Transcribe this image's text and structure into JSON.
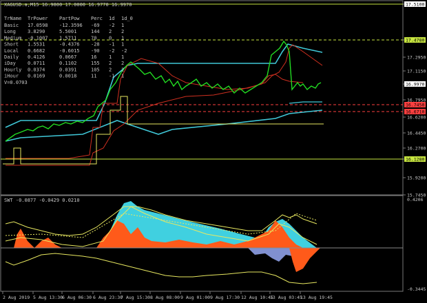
{
  "main_panel": {
    "title": "XAGUSD.a,M15  16.9800 17.0000 16.9770 16.9970",
    "table": {
      "headers": [
        "TrName",
        "TrPower",
        "PartPow",
        "Perc",
        "1d",
        "1d_0"
      ],
      "rows": [
        [
          "Basic",
          "17.0598",
          "-12.3596",
          "-69",
          "-2",
          "1"
        ],
        [
          "Long",
          "3.8290",
          "5.5001",
          "144",
          "2",
          "2"
        ],
        [
          "Medium",
          "-0.1007",
          "1.5711",
          "70",
          "0",
          "1"
        ],
        [
          "Short",
          "1.5531",
          "-0.4376",
          "-28",
          "-1",
          "1"
        ],
        [
          "Local",
          "0.6682",
          "-0.6015",
          "-90",
          "-2",
          "-2"
        ],
        [
          "Daily",
          "0.4126",
          "0.0667",
          "16",
          "1",
          "1"
        ],
        [
          "iDay",
          "0.0711",
          "0.1102",
          "155",
          "2",
          "2"
        ],
        [
          "Hourly",
          "0.0374",
          "0.0391",
          "105",
          "2",
          "2"
        ],
        [
          "iHour",
          "0.0169",
          "0.0018",
          "11",
          "-1",
          "1"
        ]
      ],
      "footer": "V=0.0703"
    },
    "price_axis": [
      "17.5100",
      "17.4780",
      "17.2950",
      "17.1150",
      "16.9970",
      "16.7950",
      "16.6200",
      "16.4450",
      "16.2700",
      "16.1280",
      "15.9200",
      "15.7450"
    ],
    "price_tags": [
      {
        "label": "17.5100",
        "color": "#ffffff"
      },
      {
        "label": "17.4780",
        "color": "#c8e640"
      },
      {
        "label": "16.9970",
        "color": "#ffffff"
      },
      {
        "label": "16.7450",
        "color": "#ff4040"
      },
      {
        "label": "16.6710",
        "color": "#ff4040"
      },
      {
        "label": "16.1280",
        "color": "#c8e640"
      }
    ]
  },
  "osc_panel": {
    "title": "SWT -0.0877 -0.0429 0.0210",
    "axis": [
      "0.4206",
      "-0.3445"
    ]
  },
  "time_axis": [
    "2 Aug 2019",
    "5 Aug 13:30",
    "6 Aug 06:30",
    "6 Aug 23:30",
    "7 Aug 15:30",
    "8 Aug 08:00",
    "9 Aug 01:00",
    "9 Aug 17:30",
    "12 Aug 10:45",
    "13 Aug 03:45",
    "13 Aug 19:45"
  ],
  "colors": {
    "price": "#22dd22",
    "cyan": "#40c8d8",
    "red": "#d03020",
    "yellow": "#e8e860",
    "osc_fill_cyan": "#40d0e0",
    "osc_fill_orange": "#ff5a1a",
    "osc_fill_blue": "#8090d0"
  }
}
